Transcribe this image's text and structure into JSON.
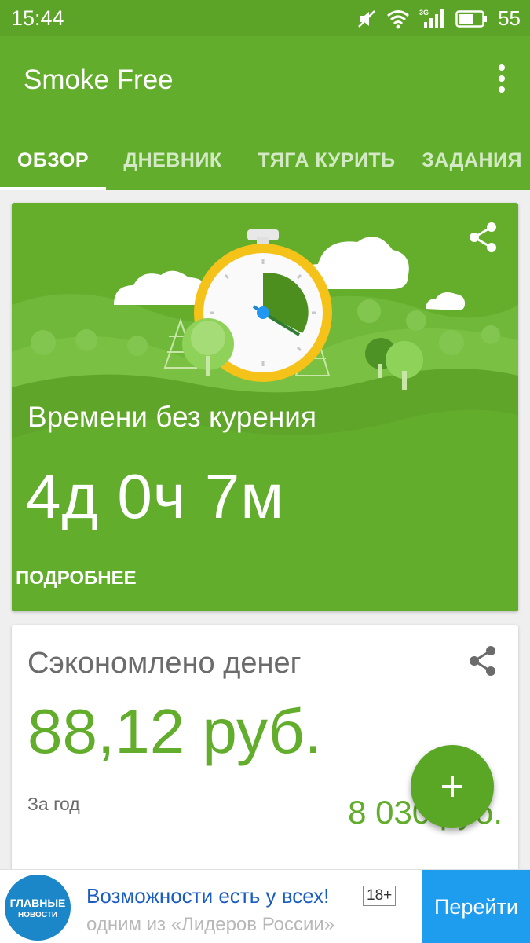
{
  "status_bar": {
    "time": "15:44",
    "network": "3G",
    "battery_level": "55",
    "icons": [
      "mute-icon",
      "wifi-icon",
      "signal-icon",
      "battery-icon"
    ]
  },
  "app_bar": {
    "title": "Smoke Free",
    "menu_icon": "more-vert-icon",
    "tabs": [
      {
        "label": "ОБЗОР",
        "active": true
      },
      {
        "label": "ДНЕВНИК",
        "active": false
      },
      {
        "label": "ТЯГА КУРИТЬ",
        "active": false
      },
      {
        "label": "ЗАДАНИЯ",
        "active": false
      }
    ]
  },
  "hero_card": {
    "label": "Времени без курения",
    "value": "4д 0ч 7м",
    "more_link": "ПОДРОБНЕЕ",
    "share_icon": "share-icon",
    "illustration": "stopwatch-with-trees-and-clouds"
  },
  "money_card": {
    "label": "Сэкономлено денег",
    "value": "88,12 руб.",
    "period_label": "За год",
    "year_value": "8 030 руб.",
    "share_icon": "share-icon"
  },
  "fab": {
    "icon": "plus-icon"
  },
  "ad": {
    "logo_line1": "ГЛАВНЫЕ",
    "logo_line2": "НОВОСТИ",
    "title": "Возможности есть у всех!",
    "age_rating": "18+",
    "subtitle": "одним из «Лидеров России»",
    "button": "Перейти"
  },
  "colors": {
    "primary": "#62ad2c",
    "status_bar": "#5ca427",
    "accent_text": "#62ad2c",
    "ad_button": "#1e9cee"
  }
}
